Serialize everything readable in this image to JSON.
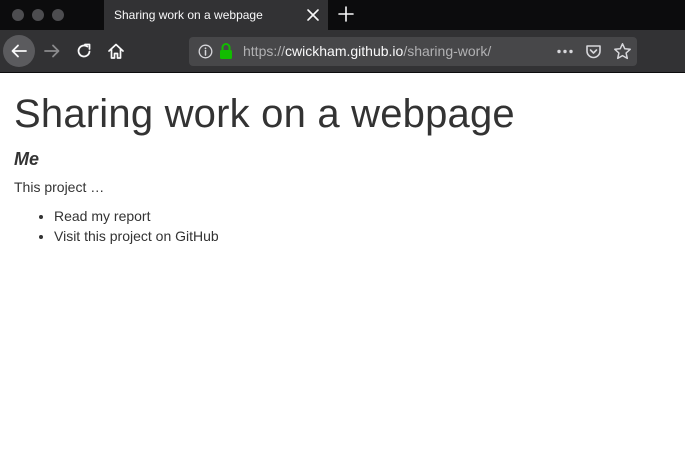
{
  "window": {
    "traffic_lights": [
      "close",
      "minimize",
      "zoom"
    ],
    "colors": {
      "titlebar": "#0c0c0d",
      "toolbar": "#323234",
      "urlbar": "#474749",
      "secure_lock": "#12bc00"
    }
  },
  "tab": {
    "title": "Sharing work on a webpage",
    "close_icon": "close-icon",
    "new_tab_icon": "plus-icon"
  },
  "navbar": {
    "back_icon": "arrow-left-icon",
    "forward_icon": "arrow-right-icon",
    "reload_icon": "reload-icon",
    "home_icon": "home-icon"
  },
  "urlbar": {
    "scheme": "https://",
    "host": "cwickham.github.io",
    "path": "/sharing-work/",
    "info_icon": "info-icon",
    "lock_icon": "lock-icon",
    "more_icon": "more-horizontal-icon",
    "pocket_icon": "pocket-icon",
    "bookmark_icon": "star-icon"
  },
  "page": {
    "title": "Sharing work on a webpage",
    "author": "Me",
    "intro": "This project …",
    "links": [
      {
        "label": "Read my report"
      },
      {
        "label": "Visit this project on GitHub"
      }
    ]
  }
}
